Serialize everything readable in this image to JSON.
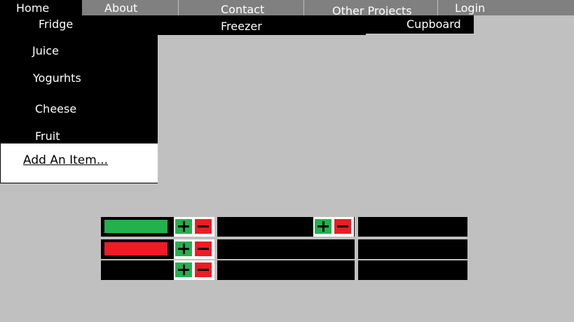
{
  "nav": {
    "home": "Home",
    "about": "About",
    "contact": "Contact",
    "other_projects": "Other Projects",
    "login": "Login"
  },
  "categories": {
    "fridge": "Fridge",
    "freezer": "Freezer",
    "cupboard": "Cupboard"
  },
  "fridge_menu": {
    "items": [
      "Juice",
      "Yogurhts",
      "Cheese",
      "Fruit"
    ],
    "add_item": "Add An Item..."
  },
  "colors": {
    "bar_green": "#22b14c",
    "bar_red": "#ed1c24",
    "background": "#c0c0c0"
  },
  "icons": {
    "increase": "plus-icon",
    "decrease": "minus-icon"
  }
}
